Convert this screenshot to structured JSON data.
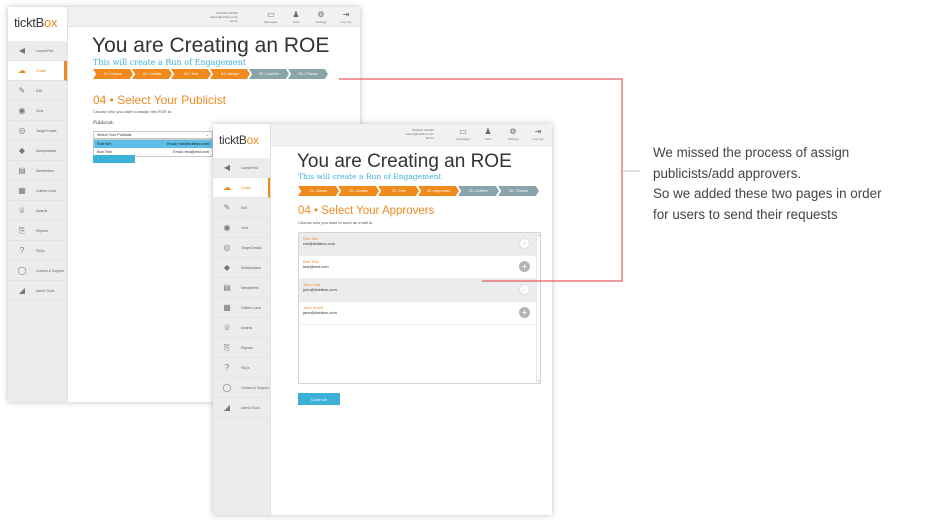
{
  "back_screen": {
    "logo": {
      "a": "tickt",
      "b": "B",
      "x": "x",
      "o": "o"
    },
    "user": {
      "name": "ROHAN ADABS",
      "email": "admin@ticktbox.com",
      "role": "admin"
    },
    "top_icons": [
      {
        "label": "Messages",
        "icon": "inbox-icon",
        "glyph": "▭"
      },
      {
        "label": "Tools",
        "icon": "people-icon",
        "glyph": "♟"
      },
      {
        "label": "Settings",
        "icon": "gear-icon",
        "glyph": "⚙"
      },
      {
        "label": "Log Out",
        "icon": "logout-icon",
        "glyph": "⇥"
      }
    ],
    "nav": [
      {
        "label": "LaunchPad",
        "glyph": "◀",
        "name": "launchpad"
      },
      {
        "label": "Create",
        "glyph": "☁",
        "name": "create"
      },
      {
        "label": "Edit",
        "glyph": "✎",
        "name": "edit"
      },
      {
        "label": "View",
        "glyph": "◉",
        "name": "view"
      },
      {
        "label": "Target Emails",
        "glyph": "◎",
        "name": "target-emails"
      },
      {
        "label": "Sweepstakes",
        "glyph": "◆",
        "name": "sweepstakes"
      },
      {
        "label": "Newsletters",
        "glyph": "▤",
        "name": "newsletters"
      },
      {
        "label": "Outlets Local",
        "glyph": "▦",
        "name": "outlets-local"
      },
      {
        "label": "Awards",
        "glyph": "♕",
        "name": "awards"
      },
      {
        "label": "Reports",
        "glyph": "⎘",
        "name": "reports"
      },
      {
        "label": "FAQs",
        "glyph": "?",
        "name": "faqs"
      },
      {
        "label": "Contact & Support",
        "glyph": "◯",
        "name": "contact-support"
      },
      {
        "label": "Admin Tools",
        "glyph": "◢",
        "name": "admin-tools"
      }
    ],
    "title": "You are Creating an ROE",
    "subtitle": "This will create a Run of Engagement",
    "steps": [
      "01 • House",
      "02 • Details",
      "03 • Text",
      "04 • Assign",
      "05 • Confirm",
      "06 • Thanks"
    ],
    "section_title": "04 • Select Your Publicist",
    "section_desc": "Choose who you want to assign this ROE to.",
    "field_label": "Publicist:",
    "select_value": "Select Your Publicist",
    "options": [
      {
        "name": "Rob Kim",
        "email": "Email: rob@ticktbox.com"
      },
      {
        "name": "Bob Test",
        "email": "Email: test@test.com"
      }
    ],
    "colors": {
      "accent": "#f08a1c",
      "blue": "#3db0d8",
      "step_inactive": "#8aa4ab"
    }
  },
  "front_screen": {
    "user": {
      "name": "ROHAN ADABS",
      "email": "admin@ticktbox.com",
      "role": "admin"
    },
    "top_icons": [
      {
        "label": "Messages",
        "icon": "inbox-icon",
        "glyph": "▭"
      },
      {
        "label": "Tools",
        "icon": "people-icon",
        "glyph": "♟"
      },
      {
        "label": "Settings",
        "icon": "gear-icon",
        "glyph": "⚙"
      },
      {
        "label": "Log Out",
        "icon": "logout-icon",
        "glyph": "⇥"
      }
    ],
    "nav": [
      {
        "label": "LaunchPad",
        "glyph": "◀",
        "name": "launchpad"
      },
      {
        "label": "Create",
        "glyph": "☁",
        "name": "create"
      },
      {
        "label": "Edit",
        "glyph": "✎",
        "name": "edit"
      },
      {
        "label": "View",
        "glyph": "◉",
        "name": "view"
      },
      {
        "label": "Target Emails",
        "glyph": "◎",
        "name": "target-emails"
      },
      {
        "label": "Sweepstakes",
        "glyph": "◆",
        "name": "sweepstakes"
      },
      {
        "label": "Newsletters",
        "glyph": "▤",
        "name": "newsletters"
      },
      {
        "label": "Outlets Local",
        "glyph": "▦",
        "name": "outlets-local"
      },
      {
        "label": "Awards",
        "glyph": "♕",
        "name": "awards"
      },
      {
        "label": "Reports",
        "glyph": "⎘",
        "name": "reports"
      },
      {
        "label": "FAQs",
        "glyph": "?",
        "name": "faqs"
      },
      {
        "label": "Contact & Support",
        "glyph": "◯",
        "name": "contact-support"
      },
      {
        "label": "Admin Tools",
        "glyph": "◢",
        "name": "admin-tools"
      }
    ],
    "title": "You are Creating an ROE",
    "subtitle": "This will create a Run of Engagement",
    "steps": [
      "01 • House",
      "02 • Details",
      "03 • Text",
      "04 • Approvals",
      "05 • Confirm",
      "06 • Thanks"
    ],
    "section_title": "04 • Select Your Approvers",
    "section_desc": "Choose who you want to send an email to.",
    "approvers": [
      {
        "name": "Rob Kim",
        "email": "rob@ticktbox.com",
        "selected": true
      },
      {
        "name": "Bob Test",
        "email": "test@test.com",
        "selected": false
      },
      {
        "name": "John Doe",
        "email": "john@ticktbox.com",
        "selected": true
      },
      {
        "name": "Jane Smith",
        "email": "jane@ticktbox.com",
        "selected": false
      }
    ],
    "continue_label": "Continue",
    "colors": {
      "connector": "#e03a3a"
    }
  },
  "annotation": {
    "lines": [
      "We missed the process of assign",
      "publicists/add approvers.",
      "So we added these two pages in order",
      "for users to send their requests"
    ]
  }
}
